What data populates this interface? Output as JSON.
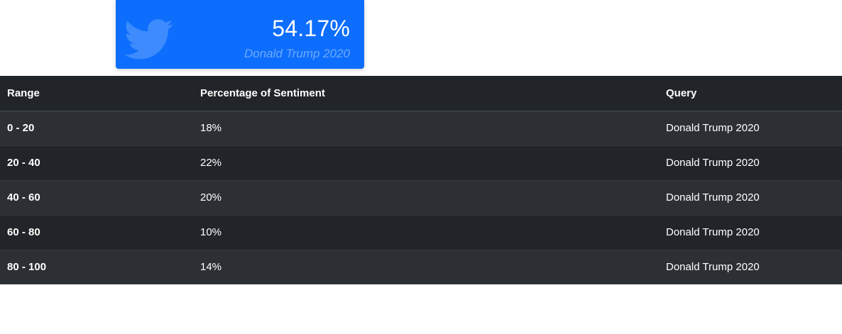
{
  "card": {
    "value": "54.17%",
    "caption": "Donald Trump 2020",
    "icon": "twitter-bird-icon",
    "background_color": "#0d6efd"
  },
  "table": {
    "headers": [
      "Range",
      "Percentage of Sentiment",
      "Query"
    ],
    "rows": [
      {
        "range": "0 - 20",
        "percentage": "18%",
        "query": "Donald Trump 2020"
      },
      {
        "range": "20 - 40",
        "percentage": "22%",
        "query": "Donald Trump 2020"
      },
      {
        "range": "40 - 60",
        "percentage": "20%",
        "query": "Donald Trump 2020"
      },
      {
        "range": "60 - 80",
        "percentage": "10%",
        "query": "Donald Trump 2020"
      },
      {
        "range": "80 - 100",
        "percentage": "14%",
        "query": "Donald Trump 2020"
      }
    ]
  }
}
